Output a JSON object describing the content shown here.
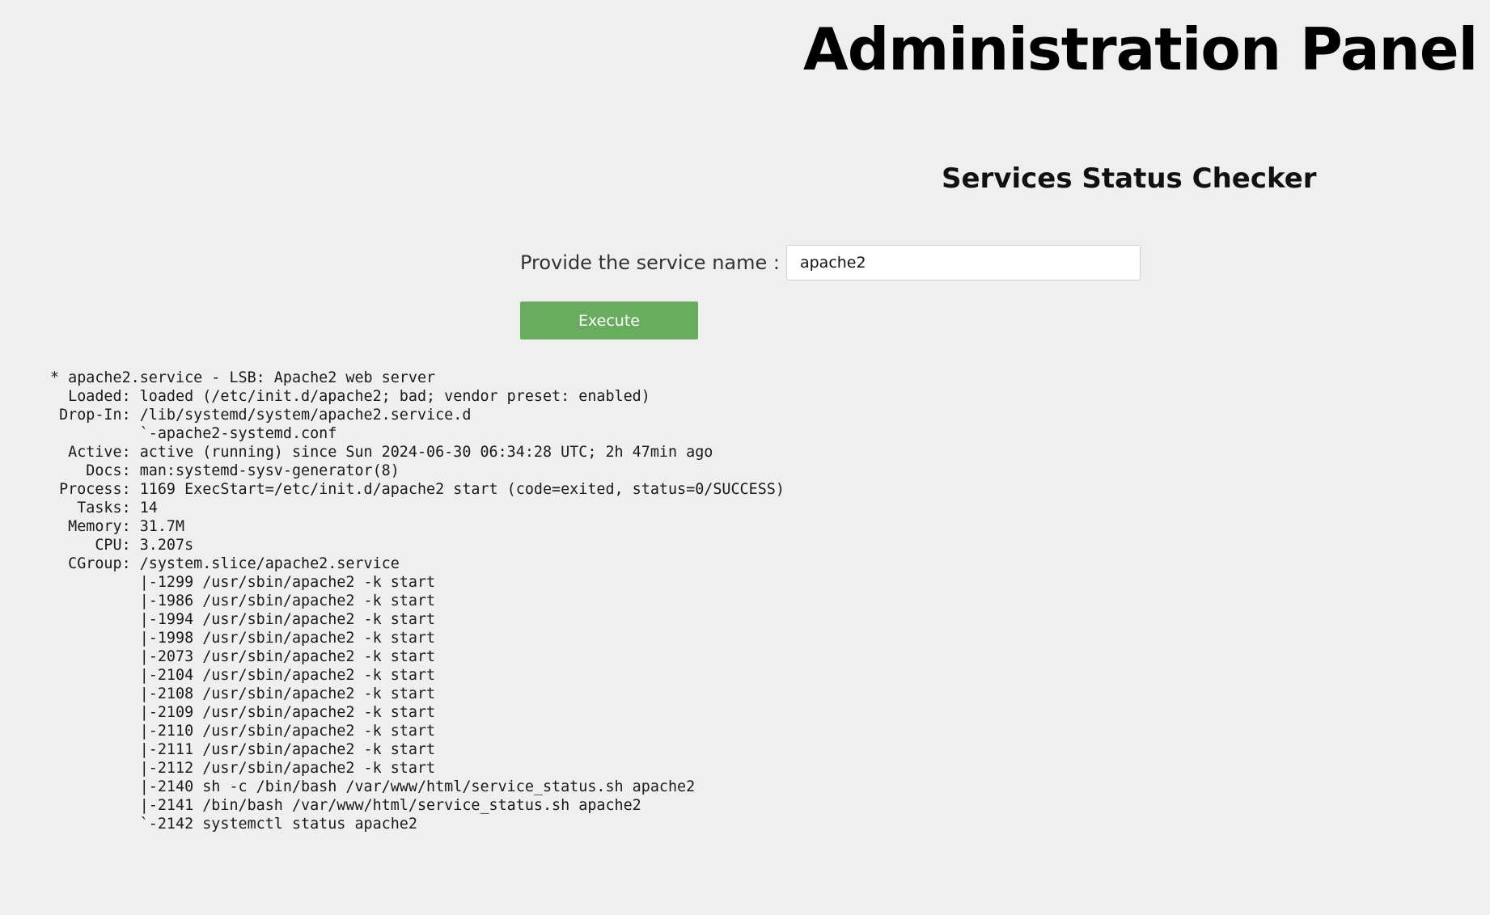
{
  "header": {
    "title": "Administration Panel"
  },
  "checker": {
    "title": "Services Status Checker",
    "field_label": "Provide the service name :",
    "service_value": "apache2",
    "execute_label": "Execute"
  },
  "output": {
    "lines": [
      "* apache2.service - LSB: Apache2 web server",
      "  Loaded: loaded (/etc/init.d/apache2; bad; vendor preset: enabled)",
      " Drop-In: /lib/systemd/system/apache2.service.d",
      "          `-apache2-systemd.conf",
      "  Active: active (running) since Sun 2024-06-30 06:34:28 UTC; 2h 47min ago",
      "    Docs: man:systemd-sysv-generator(8)",
      " Process: 1169 ExecStart=/etc/init.d/apache2 start (code=exited, status=0/SUCCESS)",
      "   Tasks: 14",
      "  Memory: 31.7M",
      "     CPU: 3.207s",
      "  CGroup: /system.slice/apache2.service",
      "          |-1299 /usr/sbin/apache2 -k start",
      "          |-1986 /usr/sbin/apache2 -k start",
      "          |-1994 /usr/sbin/apache2 -k start",
      "          |-1998 /usr/sbin/apache2 -k start",
      "          |-2073 /usr/sbin/apache2 -k start",
      "          |-2104 /usr/sbin/apache2 -k start",
      "          |-2108 /usr/sbin/apache2 -k start",
      "          |-2109 /usr/sbin/apache2 -k start",
      "          |-2110 /usr/sbin/apache2 -k start",
      "          |-2111 /usr/sbin/apache2 -k start",
      "          |-2112 /usr/sbin/apache2 -k start",
      "          |-2140 sh -c /bin/bash /var/www/html/service_status.sh apache2",
      "          |-2141 /bin/bash /var/www/html/service_status.sh apache2",
      "          `-2142 systemctl status apache2"
    ]
  }
}
